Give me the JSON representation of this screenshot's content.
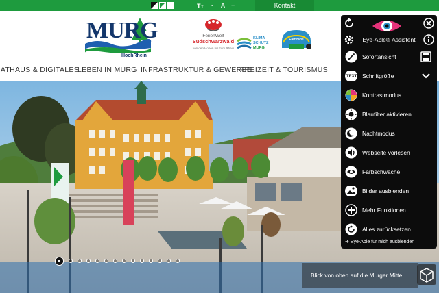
{
  "topbar": {
    "icons": [
      "contrast-inverted-icon",
      "contrast-normal-icon",
      "contrast-light-icon",
      "font-size-icon"
    ],
    "font_minus": "-",
    "font_a": "A",
    "font_plus": "+",
    "contact": "Kontakt"
  },
  "header": {
    "logo_word": "MURG",
    "logo_sub": "HochRhein",
    "partners": [
      {
        "name": "FerienWelt Südschwarzwald",
        "line1": "FerienWelt",
        "line2": "Südschwarzwald",
        "tagline": "von den Hohen bis zum Rhein"
      },
      {
        "name": "Klima Schutz Murg",
        "line1": "KLIMA",
        "line2": "SCHUTZ",
        "line3": "MURG"
      },
      {
        "name": "Fairtrade Gemeinde",
        "line1": "Fairtrade"
      }
    ]
  },
  "nav": {
    "items": [
      "RATHAUS & DIGITALES",
      "LEBEN IN MURG",
      "INFRASTRUKTUR & GEWERBE",
      "FREIZEIT & TOURISMUS"
    ]
  },
  "hero": {
    "caption": "Blick von oben auf die Murger Mitte",
    "slide_count": 15,
    "active_slide": 1
  },
  "accessibility_panel": {
    "title": "Eye-Able® Assistent",
    "items": [
      {
        "label": "Sofortansicht",
        "icon": "rocket-icon"
      },
      {
        "label": "Schriftgröße",
        "icon": "text-size-icon"
      },
      {
        "label": "Kontrastmodus",
        "icon": "color-wheel-icon"
      },
      {
        "label": "Blaufilter aktivieren",
        "icon": "sun-icon"
      },
      {
        "label": "Nachtmodus",
        "icon": "moon-icon"
      },
      {
        "label": "Webseite vorlesen",
        "icon": "speaker-icon"
      },
      {
        "label": "Farbschwäche",
        "icon": "eye-settings-icon"
      },
      {
        "label": "Bilder ausblenden",
        "icon": "image-icon"
      },
      {
        "label": "Mehr Funktionen",
        "icon": "plus-circle-icon"
      },
      {
        "label": "Alles zurücksetzen",
        "icon": "reset-icon"
      }
    ],
    "hide_label": "➜ Eye-Able für mich ausblenden"
  },
  "colors": {
    "brand_green": "#1e9b3e",
    "panel_bg": "#0c0c0c",
    "logo_blue": "#13366b",
    "eye_pink": "#e6327a"
  }
}
